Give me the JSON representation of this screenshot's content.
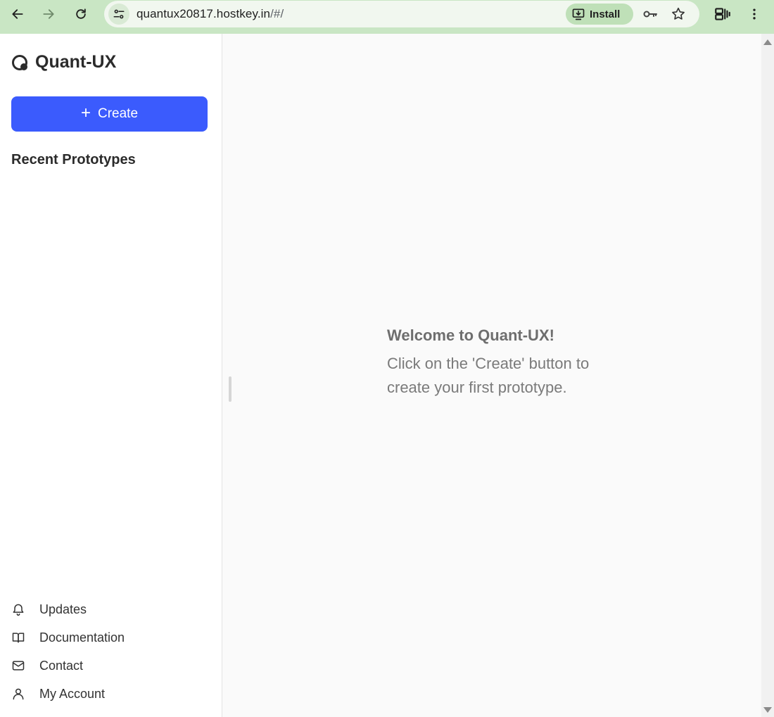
{
  "browser": {
    "url_host": "quantux20817.hostkey.in",
    "url_path": "/#/",
    "install_label": "Install"
  },
  "sidebar": {
    "logo_text": "Quant-UX",
    "create_label": "Create",
    "recent_title": "Recent Prototypes",
    "footer_items": [
      {
        "label": "Updates",
        "icon": "bell-icon"
      },
      {
        "label": "Documentation",
        "icon": "book-icon"
      },
      {
        "label": "Contact",
        "icon": "mail-icon"
      },
      {
        "label": "My Account",
        "icon": "user-icon"
      }
    ]
  },
  "main": {
    "welcome_title": "Welcome to Quant-UX!",
    "welcome_text": "Click on the 'Create' button to create your first prototype."
  },
  "colors": {
    "chrome_bg": "#c9e6c4",
    "accent": "#3b5bfd"
  }
}
